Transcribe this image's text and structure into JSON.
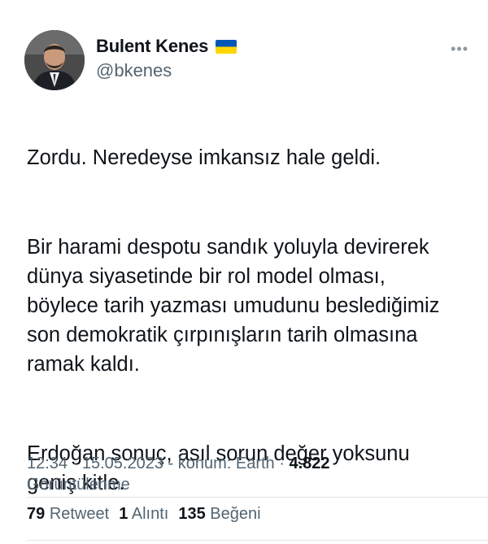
{
  "author": {
    "display_name": "Bulent Kenes",
    "handle": "@bkenes",
    "flag_icon": "ukraine-flag-icon"
  },
  "tweet": {
    "paragraphs": [
      "Zordu. Neredeyse imkansız hale geldi.",
      "Bir harami despotu sandık yoluyla devirerek\ndünya siyasetinde bir rol model olması,\nböylece tarih yazması umudunu beslediğimiz\nson demokratik çırpınışların tarih olmasına\nramak kaldı.",
      "Erdoğan sonuç, asıl sorun değer yoksunu\ngeniş kitle."
    ]
  },
  "meta": {
    "time": "12:34",
    "date": "15.05.2023",
    "location": "konum: Earth",
    "views_count": "4.822",
    "views_label": "Görüntülenme"
  },
  "stats": {
    "retweets_count": "79",
    "retweets_label": "Retweet",
    "quotes_count": "1",
    "quotes_label": "Alıntı",
    "likes_count": "135",
    "likes_label": "Beğeni"
  },
  "colors": {
    "text": "#0f1419",
    "secondary": "#536471",
    "flag_blue": "#0057b7",
    "flag_yellow": "#ffd700"
  }
}
